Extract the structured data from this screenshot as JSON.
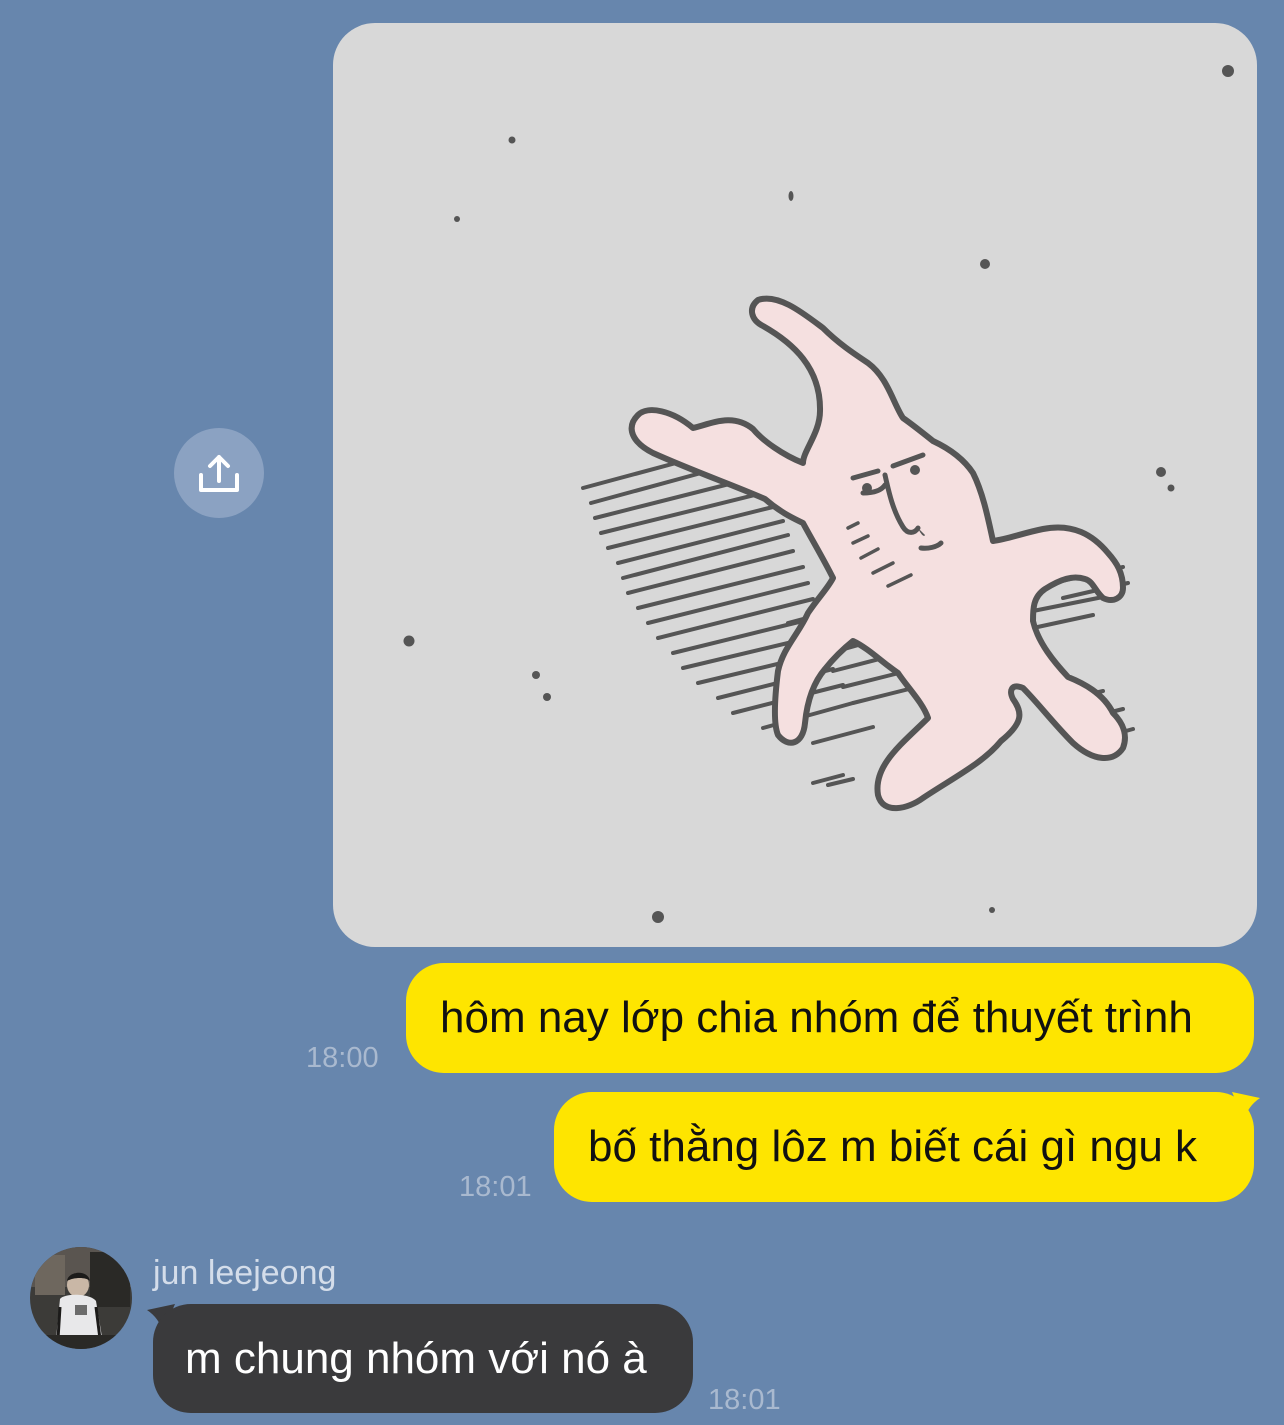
{
  "chat": {
    "messages": [
      {
        "id": "sticker",
        "type": "sticker",
        "direction": "outgoing",
        "icon": "share-icon"
      },
      {
        "id": "out1",
        "type": "text",
        "direction": "outgoing",
        "text": "hôm nay lớp chia nhóm để thuyết trình",
        "time": "18:00"
      },
      {
        "id": "out2",
        "type": "text",
        "direction": "outgoing",
        "text": "bố thằng lôz m biết cái gì ngu k",
        "time": "18:01"
      },
      {
        "id": "in1",
        "type": "text",
        "direction": "incoming",
        "sender": "jun leejeong",
        "text": "m chung nhóm với nó à",
        "time": "18:01"
      }
    ]
  },
  "colors": {
    "background": "#6786ad",
    "outgoing_bubble": "#fee500",
    "incoming_bubble": "#3a3a3c",
    "timestamp": "#a9b9cf",
    "sticker_bg": "#d8d8d8",
    "character_fill": "#f5e0e0",
    "character_stroke": "#555555"
  }
}
